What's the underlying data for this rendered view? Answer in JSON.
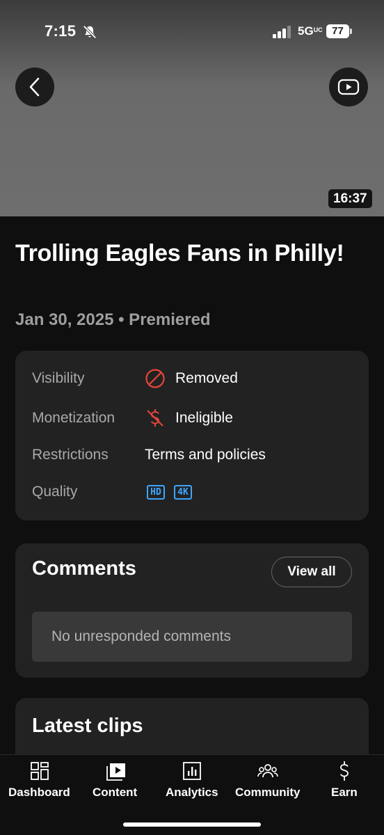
{
  "status_bar": {
    "time": "7:15",
    "network": "5G",
    "network_suffix": "UC",
    "battery": "77"
  },
  "video": {
    "duration": "16:37",
    "title": "Trolling Eagles Fans in Philly!",
    "meta": "Jan 30, 2025 • Premiered"
  },
  "details": {
    "visibility_label": "Visibility",
    "visibility_value": "Removed",
    "monetization_label": "Monetization",
    "monetization_value": "Ineligible",
    "restrictions_label": "Restrictions",
    "restrictions_value": "Terms and policies",
    "quality_label": "Quality",
    "quality_badges": [
      "HD",
      "4K"
    ]
  },
  "comments": {
    "title": "Comments",
    "view_all": "View all",
    "empty_text": "No unresponded comments"
  },
  "clips": {
    "title": "Latest clips"
  },
  "bottom_nav": [
    {
      "label": "Dashboard",
      "icon": "dashboard-icon"
    },
    {
      "label": "Content",
      "icon": "content-icon"
    },
    {
      "label": "Analytics",
      "icon": "analytics-icon"
    },
    {
      "label": "Community",
      "icon": "community-icon"
    },
    {
      "label": "Earn",
      "icon": "earn-icon"
    }
  ],
  "colors": {
    "background": "#0f0f0f",
    "card": "#222222",
    "alert_red": "#e8453c",
    "badge_blue": "#3ea6ff"
  }
}
